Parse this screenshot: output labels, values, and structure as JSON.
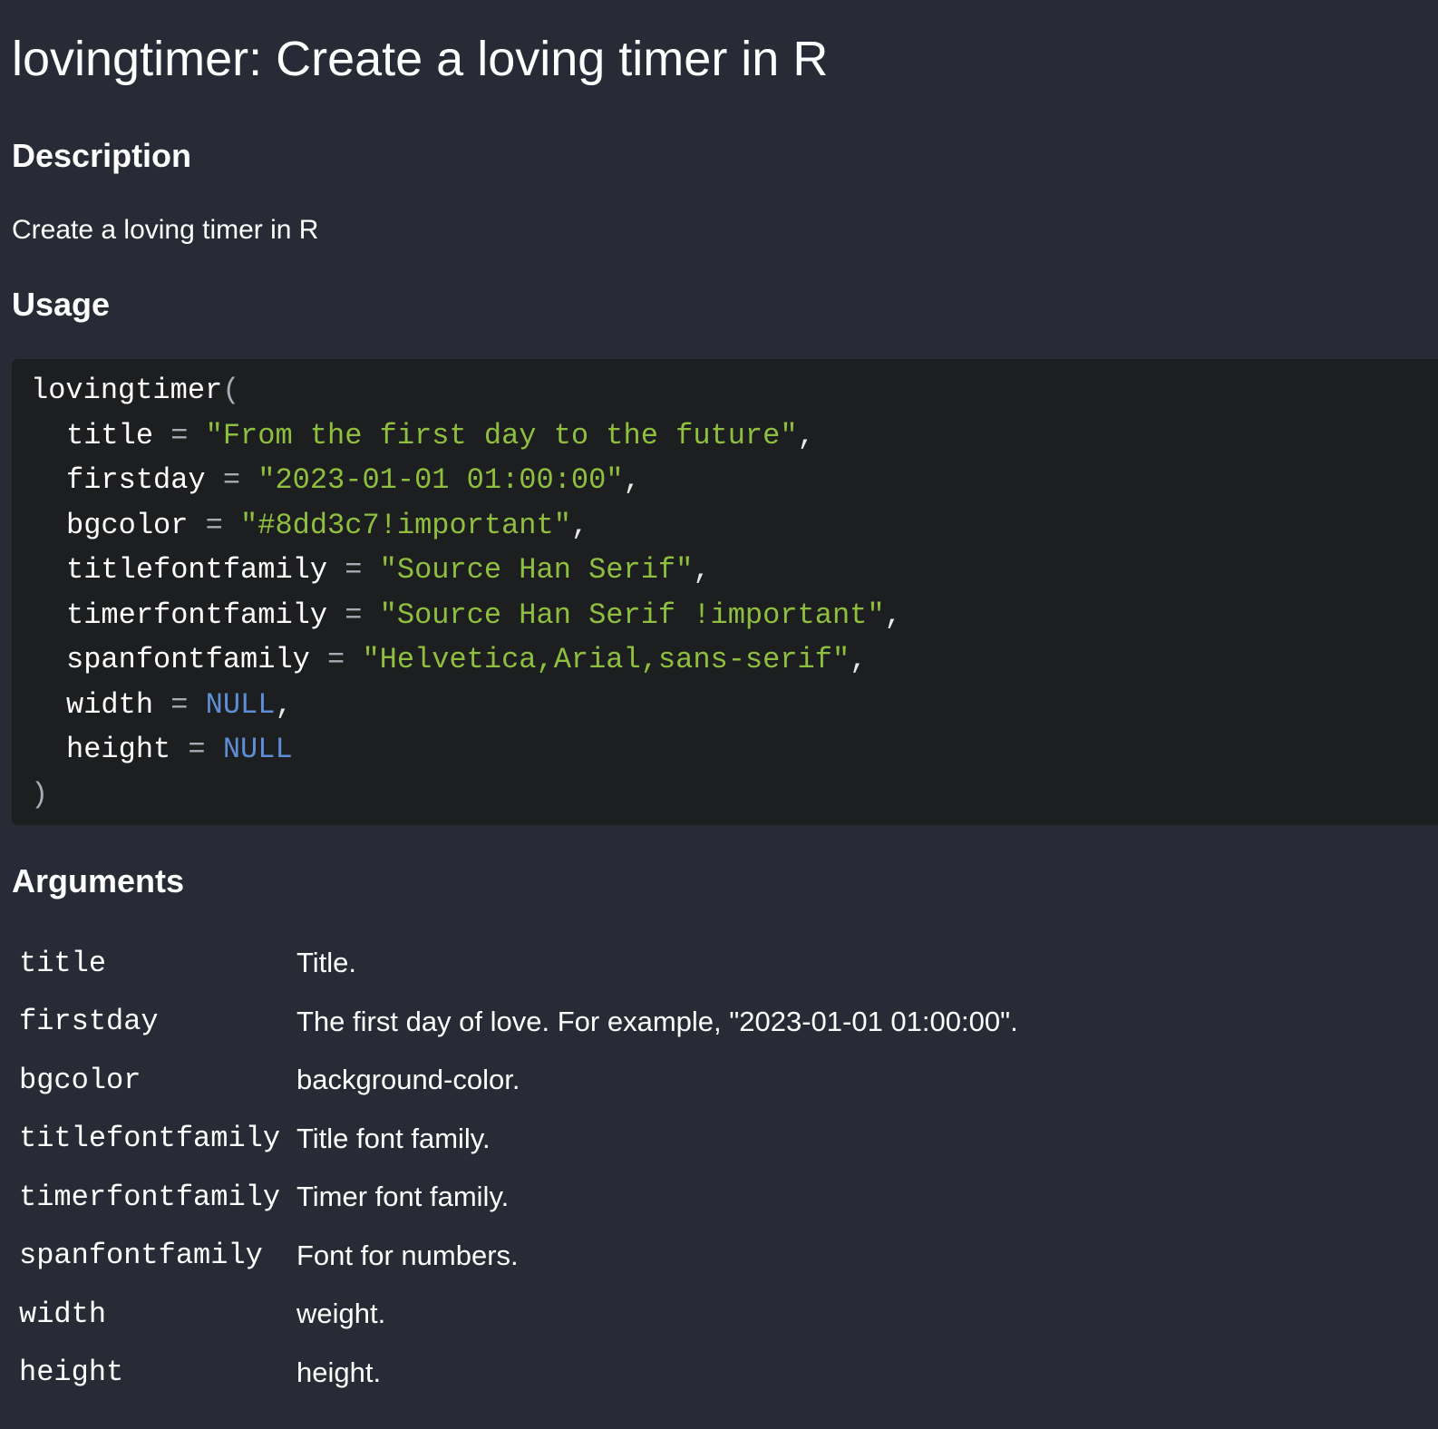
{
  "title": "lovingtimer: Create a loving timer in R",
  "sections": {
    "description": {
      "heading": "Description",
      "text": "Create a loving timer in R"
    },
    "usage": {
      "heading": "Usage",
      "function_name": "lovingtimer",
      "open_paren": "(",
      "close_paren": ")",
      "params": [
        {
          "name": "title",
          "op": "=",
          "value": "\"From the first day to the future\"",
          "type": "string",
          "trail": ","
        },
        {
          "name": "firstday",
          "op": "=",
          "value": "\"2023-01-01 01:00:00\"",
          "type": "string",
          "trail": ","
        },
        {
          "name": "bgcolor",
          "op": "=",
          "value": "\"#8dd3c7!important\"",
          "type": "string",
          "trail": ","
        },
        {
          "name": "titlefontfamily",
          "op": "=",
          "value": "\"Source Han Serif\"",
          "type": "string",
          "trail": ","
        },
        {
          "name": "timerfontfamily",
          "op": "=",
          "value": "\"Source Han Serif !important\"",
          "type": "string",
          "trail": ","
        },
        {
          "name": "spanfontfamily",
          "op": "=",
          "value": "\"Helvetica,Arial,sans-serif\"",
          "type": "string",
          "trail": ","
        },
        {
          "name": "width",
          "op": "=",
          "value": "NULL",
          "type": "null",
          "trail": ","
        },
        {
          "name": "height",
          "op": "=",
          "value": "NULL",
          "type": "null",
          "trail": ""
        }
      ]
    },
    "arguments": {
      "heading": "Arguments",
      "rows": [
        {
          "name": "title",
          "desc": "Title."
        },
        {
          "name": "firstday",
          "desc": "The first day of love. For example, \"2023-01-01 01:00:00\"."
        },
        {
          "name": "bgcolor",
          "desc": "background-color."
        },
        {
          "name": "titlefontfamily",
          "desc": "Title font family."
        },
        {
          "name": "timerfontfamily",
          "desc": "Timer font family."
        },
        {
          "name": "spanfontfamily",
          "desc": "Font for numbers."
        },
        {
          "name": "width",
          "desc": "weight."
        },
        {
          "name": "height",
          "desc": "height."
        }
      ]
    }
  },
  "colors": {
    "background": "#282b35",
    "code_background": "#1d1e20",
    "string": "#8fbf3f",
    "null_keyword": "#5e8fd6",
    "operator": "#a7acb5",
    "text": "#ffffff"
  }
}
